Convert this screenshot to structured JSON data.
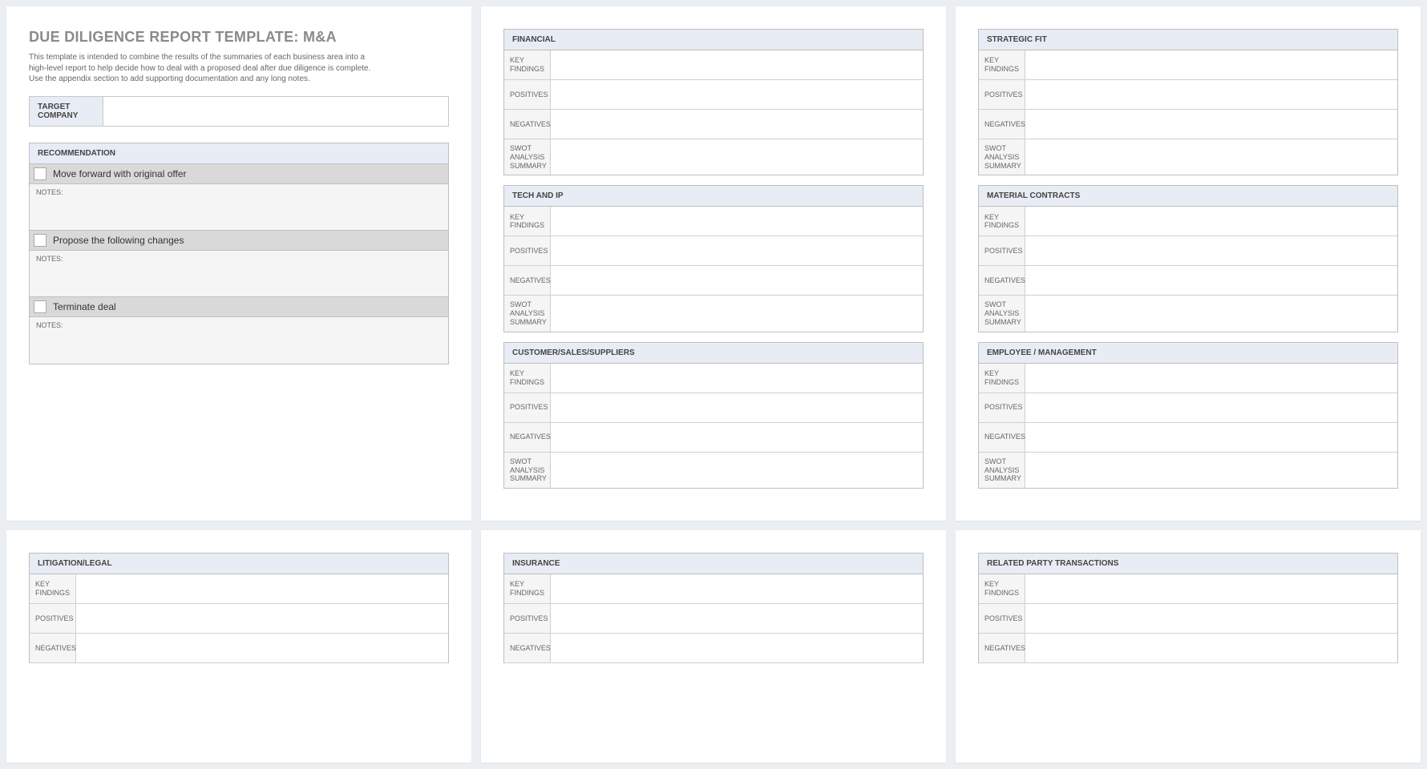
{
  "title": "DUE DILIGENCE REPORT TEMPLATE: M&A",
  "intro": "This template is intended to combine the results of the summaries of each business area into a high-level report to help decide how to deal with a proposed deal after due diligence is complete.  Use the appendix section to add supporting documentation and any long notes.",
  "target_company_label": "TARGET COMPANY",
  "recommendation_header": "RECOMMENDATION",
  "rec_options": {
    "opt1": "Move forward with original offer",
    "opt2": "Propose the following changes",
    "opt3": "Terminate deal"
  },
  "notes_label": "NOTES:",
  "row_labels": {
    "key_findings": "KEY FINDINGS",
    "positives": "POSITIVES",
    "negatives": "NEGATIVES",
    "swot": "SWOT ANALYSIS SUMMARY"
  },
  "sections": {
    "financial": "FINANCIAL",
    "tech_ip": "TECH AND IP",
    "customer": "CUSTOMER/SALES/SUPPLIERS",
    "strategic": "STRATEGIC FIT",
    "material": "MATERIAL CONTRACTS",
    "employee": "EMPLOYEE / MANAGEMENT",
    "litigation": "LITIGATION/LEGAL",
    "insurance": "INSURANCE",
    "related": "RELATED PARTY TRANSACTIONS"
  }
}
